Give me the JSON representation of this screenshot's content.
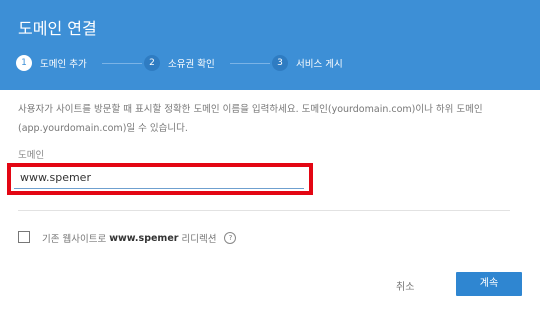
{
  "dialog": {
    "title": "도메인 연결",
    "steps": [
      {
        "number": "1",
        "label": "도메인 추가"
      },
      {
        "number": "2",
        "label": "소유권 확인"
      },
      {
        "number": "3",
        "label": "서비스 게시"
      }
    ],
    "description": "사용자가 사이트를 방문할 때 표시할 정확한 도메인 이름을 입력하세요. 도메인(yourdomain.com)이나 하위 도메인(app.yourdomain.com)일 수 있습니다.",
    "domain_label": "도메인",
    "domain_value": "www.spemer",
    "redirect": {
      "prefix": "기존 웹사이트로",
      "domain": "www.spemer",
      "suffix": "리디렉션",
      "help_icon": "?"
    },
    "cancel_label": "취소",
    "continue_label": "계속"
  },
  "colors": {
    "header": "#3d8fd6",
    "button": "#2f86d1",
    "highlight": "#e30613"
  }
}
